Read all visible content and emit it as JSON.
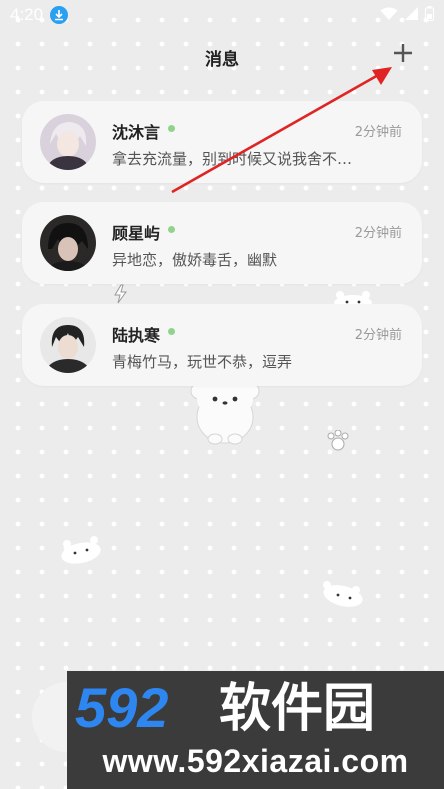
{
  "status_bar": {
    "time": "4:20"
  },
  "header": {
    "title": "消息",
    "add_icon": "plus-icon"
  },
  "conversations": [
    {
      "name": "沈沐言",
      "time": "2分钟前",
      "preview": "拿去充流量，别到时候又说我舍不…",
      "online": true
    },
    {
      "name": "顾星屿",
      "time": "2分钟前",
      "preview": "异地恋，傲娇毒舌，幽默",
      "online": true
    },
    {
      "name": "陆执寒",
      "time": "2分钟前",
      "preview": "青梅竹马，玩世不恭，逗弄",
      "online": true
    }
  ],
  "watermark": {
    "logo": "592软件园",
    "url": "www.592xiazai.com"
  },
  "colors": {
    "background": "#ececec",
    "card": "#f6f6f6",
    "online": "#8fd48a",
    "arrow": "#e02424",
    "watermark_blue": "#2e86f0"
  }
}
